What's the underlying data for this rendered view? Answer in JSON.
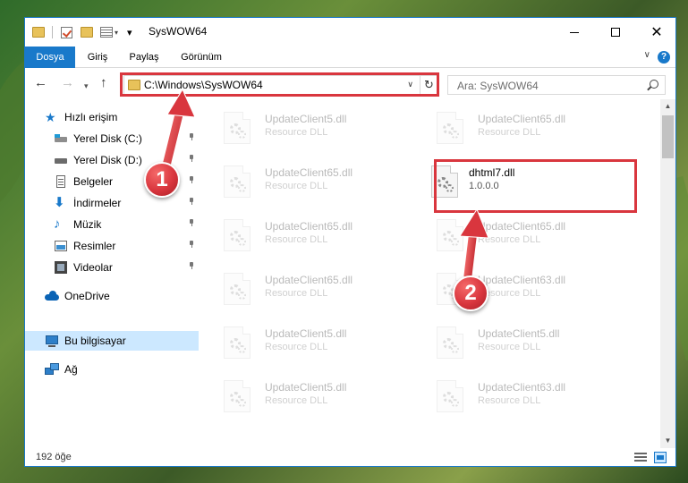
{
  "window": {
    "title": "SysWOW64",
    "controls": [
      "minimize",
      "maximize",
      "close"
    ]
  },
  "ribbon": {
    "tabs": [
      {
        "label": "Dosya",
        "active": true
      },
      {
        "label": "Giriş"
      },
      {
        "label": "Paylaş"
      },
      {
        "label": "Görünüm"
      }
    ],
    "help_label": "?"
  },
  "address": {
    "path": "C:\\Windows\\SysWOW64",
    "search_placeholder": "Ara: SysWOW64"
  },
  "nav": {
    "items": [
      {
        "label": "Hızlı erişim",
        "icon": "star-icon",
        "pinned": false
      },
      {
        "label": "Yerel Disk (C:)",
        "icon": "drive-icon",
        "pinned": true
      },
      {
        "label": "Yerel Disk (D:)",
        "icon": "drive-icon",
        "pinned": true
      },
      {
        "label": "Belgeler",
        "icon": "documents-icon",
        "pinned": true
      },
      {
        "label": "İndirmeler",
        "icon": "download-icon",
        "pinned": true
      },
      {
        "label": "Müzik",
        "icon": "music-icon",
        "pinned": true
      },
      {
        "label": "Resimler",
        "icon": "pictures-icon",
        "pinned": true
      },
      {
        "label": "Videolar",
        "icon": "video-icon",
        "pinned": true
      },
      {
        "label": "OneDrive",
        "icon": "cloud-icon",
        "pinned": false
      },
      {
        "label": "Bu bilgisayar",
        "icon": "computer-icon",
        "pinned": false,
        "selected": true
      },
      {
        "label": "Ağ",
        "icon": "network-icon",
        "pinned": false
      }
    ]
  },
  "files": {
    "left": [
      {
        "name": "UpdateClient5.dll",
        "sub": "Resource DLL"
      },
      {
        "name": "UpdateClient65.dll",
        "sub": "Resource DLL"
      },
      {
        "name": "UpdateClient65.dll",
        "sub": "Resource DLL"
      },
      {
        "name": "UpdateClient65.dll",
        "sub": "Resource DLL"
      },
      {
        "name": "UpdateClient5.dll",
        "sub": "Resource DLL"
      },
      {
        "name": "UpdateClient5.dll",
        "sub": "Resource DLL"
      }
    ],
    "right": [
      {
        "name": "UpdateClient65.dll",
        "sub": "Resource DLL"
      },
      {
        "name": "dhtml7.dll",
        "sub": "1.0.0.0",
        "highlighted": true
      },
      {
        "name": "UpdateClient65.dll",
        "sub": "Resource DLL"
      },
      {
        "name": "UpdateClient63.dll",
        "sub": "Resource DLL"
      },
      {
        "name": "UpdateClient5.dll",
        "sub": "Resource DLL"
      },
      {
        "name": "UpdateClient63.dll",
        "sub": "Resource DLL"
      }
    ]
  },
  "status": {
    "count": "192 öğe"
  },
  "annotations": {
    "badge1": "1",
    "badge2": "2",
    "color": "#d9363e"
  },
  "colors": {
    "accent": "#1979ca",
    "selection": "#cce8ff"
  }
}
